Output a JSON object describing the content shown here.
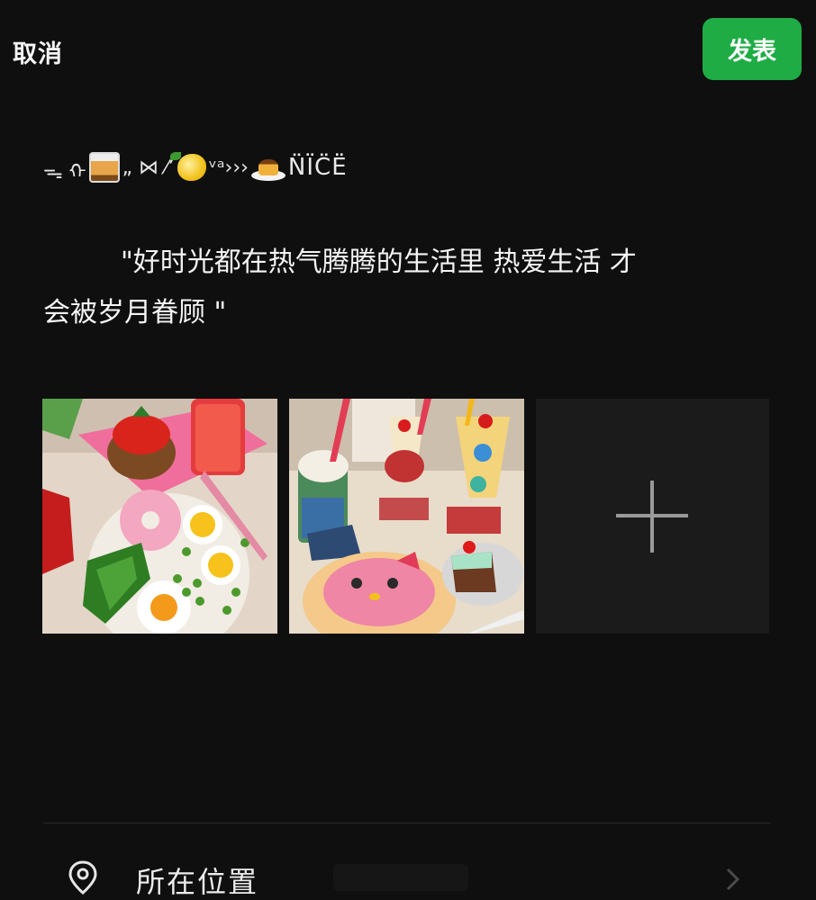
{
  "header": {
    "cancel_label": "取消",
    "publish_label": "发表",
    "publish_color": "#1fac45"
  },
  "emoji_line": {
    "prefix": "ᯓ ᡣ",
    "mid1": "„ ⋈ ⁄’",
    "mid2": "ᵛᵃ›››",
    "nice": "N̈ÏC̈Ë",
    "icons": [
      "whiskey-glass-icon",
      "lemon-icon",
      "flan-pudding-icon"
    ]
  },
  "post": {
    "line1": "\"好时光都在热气腾腾的生活里 热爱生活 才",
    "line2": "会被岁月眷顾 \""
  },
  "photos": [
    {
      "icon": "breakfast-plate-photo"
    },
    {
      "icon": "dessert-drinks-photo"
    }
  ],
  "add_photo": {
    "icon": "plus-icon"
  },
  "location": {
    "label": "所在位置",
    "icon": "location-pin-icon",
    "chevron": "chevron-right-icon"
  }
}
